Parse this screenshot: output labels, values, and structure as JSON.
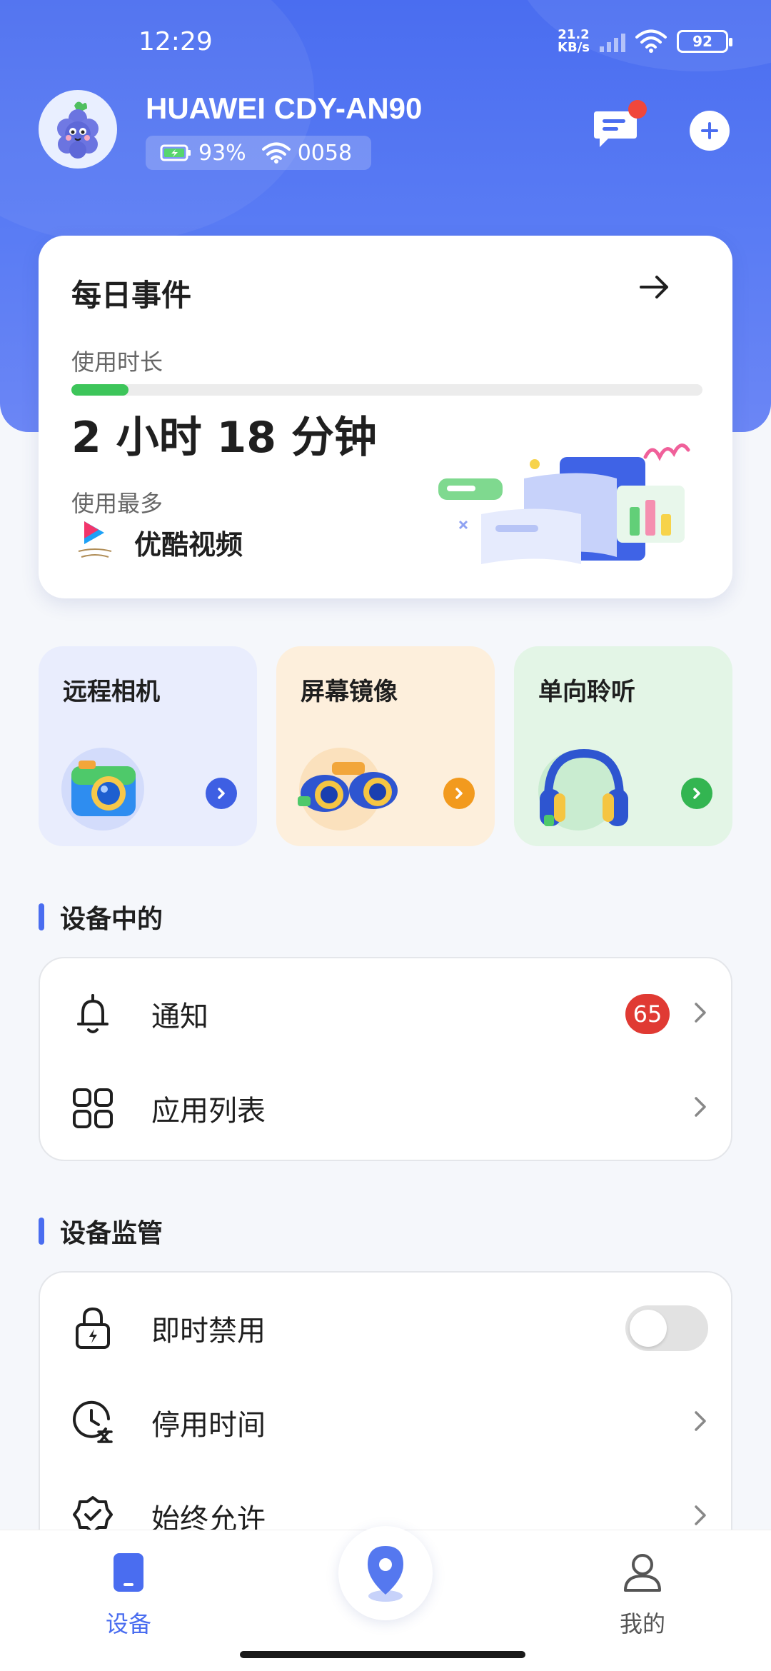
{
  "status_bar": {
    "time": "12:29",
    "net_speed_value": "21.2",
    "net_speed_unit": "KB/s",
    "battery": "92"
  },
  "device": {
    "name": "HUAWEI CDY-AN90",
    "battery": "93%",
    "wifi": "0058"
  },
  "daily": {
    "title": "每日事件",
    "usage_label": "使用时长",
    "usage_progress": 0.09,
    "usage_value": "2 小时 18 分钟",
    "most_used_label": "使用最多",
    "most_used_app": "优酷视频"
  },
  "features": [
    {
      "label": "远程相机",
      "bg": "#e9edfd",
      "accent": "#3e5fe3"
    },
    {
      "label": "屏幕镜像",
      "bg": "#fdefdc",
      "accent": "#f29a1e"
    },
    {
      "label": "单向聆听",
      "bg": "#e3f5e6",
      "accent": "#33b551"
    }
  ],
  "section_device": {
    "title": "设备中的",
    "items": [
      {
        "label": "通知",
        "badge": "65"
      },
      {
        "label": "应用列表"
      }
    ]
  },
  "section_supervise": {
    "title": "设备监管",
    "items": [
      {
        "label": "即时禁用"
      },
      {
        "label": "停用时间"
      },
      {
        "label": "始终允许"
      }
    ]
  },
  "nav": {
    "device": "设备",
    "mine": "我的"
  },
  "colors": {
    "primary": "#4a6df0",
    "green": "#3dc55a",
    "badge_red": "#e03a33"
  }
}
